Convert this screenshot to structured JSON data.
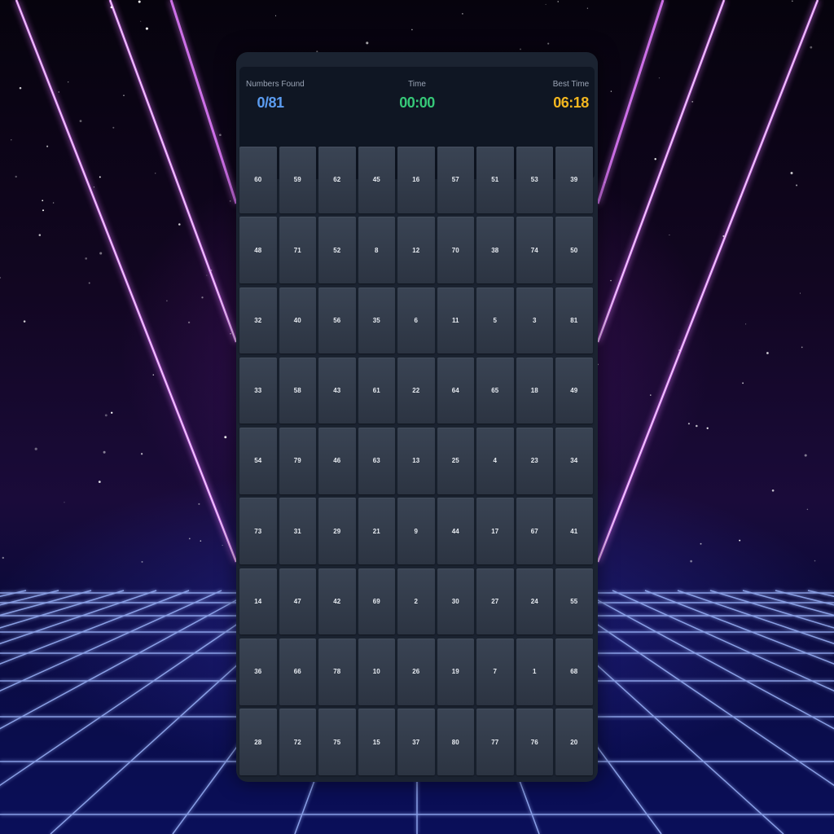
{
  "stats": {
    "found_label": "Numbers Found",
    "found_value": "0/81",
    "time_label": "Time",
    "time_value": "00:00",
    "best_label": "Best Time",
    "best_value": "06:18"
  },
  "colors": {
    "found": "#5b9cf0",
    "time": "#36c878",
    "best": "#f2b61f",
    "tile": "#333c4b",
    "panel": "#1b2331"
  },
  "grid": {
    "columns": 9,
    "rows": [
      [
        "60",
        "59",
        "62",
        "45",
        "16",
        "57",
        "51",
        "53",
        "39"
      ],
      [
        "48",
        "71",
        "52",
        "8",
        "12",
        "70",
        "38",
        "74",
        "50"
      ],
      [
        "32",
        "40",
        "56",
        "35",
        "6",
        "11",
        "5",
        "3",
        "81"
      ],
      [
        "33",
        "58",
        "43",
        "61",
        "22",
        "64",
        "65",
        "18",
        "49"
      ],
      [
        "54",
        "79",
        "46",
        "63",
        "13",
        "25",
        "4",
        "23",
        "34"
      ],
      [
        "73",
        "31",
        "29",
        "21",
        "9",
        "44",
        "17",
        "67",
        "41"
      ],
      [
        "14",
        "47",
        "42",
        "69",
        "2",
        "30",
        "27",
        "24",
        "55"
      ],
      [
        "36",
        "66",
        "78",
        "10",
        "26",
        "19",
        "7",
        "1",
        "68"
      ],
      [
        "28",
        "72",
        "75",
        "15",
        "37",
        "80",
        "77",
        "76",
        "20"
      ]
    ]
  }
}
